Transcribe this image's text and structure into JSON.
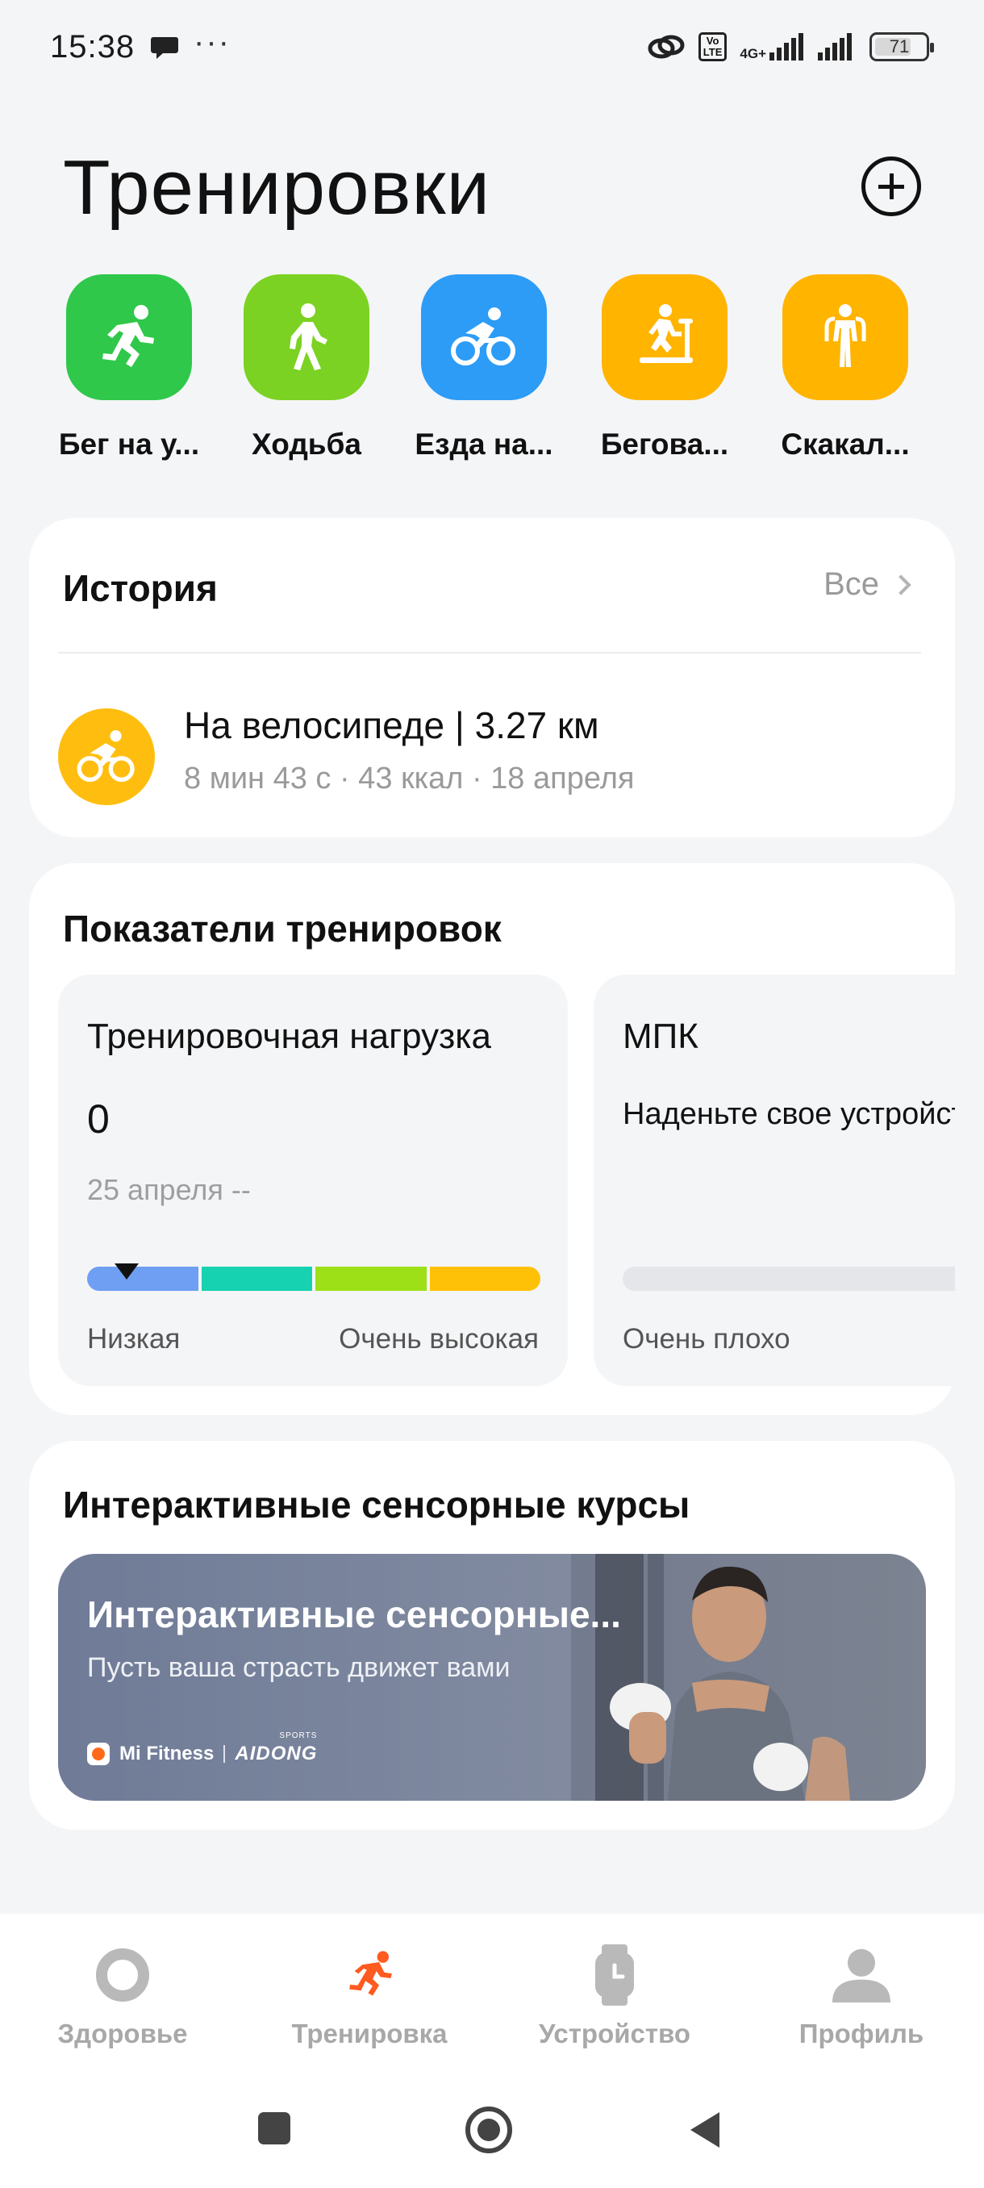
{
  "status_bar": {
    "time": "15:38",
    "dots": "···",
    "network": "4G+",
    "volte_top": "Vo",
    "volte_bottom": "LTE",
    "battery": "71"
  },
  "header": {
    "title": "Тренировки"
  },
  "workout_types": [
    {
      "label": "Бег на у...",
      "icon": "running-icon",
      "color": "#2fc84a"
    },
    {
      "label": "Ходьба",
      "icon": "walking-icon",
      "color": "#7bd222"
    },
    {
      "label": "Езда на...",
      "icon": "cycling-icon",
      "color": "#2c9cf7"
    },
    {
      "label": "Бегова...",
      "icon": "treadmill-icon",
      "color": "#ffb400"
    },
    {
      "label": "Скакал...",
      "icon": "jump-rope-icon",
      "color": "#ffb400"
    }
  ],
  "history": {
    "title": "История",
    "see_all": "Все",
    "item": {
      "title": "На велосипеде | 3.27 км",
      "subtitle": "8 мин 43 с · 43 ккал · 18 апреля",
      "icon": "cycling-icon",
      "color": "#ffbe0f"
    }
  },
  "metrics": {
    "title": "Показатели тренировок",
    "load": {
      "title": "Тренировочная нагрузка",
      "value": "0",
      "date": "25 апреля --",
      "low_label": "Низкая",
      "high_label": "Очень высокая",
      "scale_colors": [
        "#6f9ff3",
        "#16d2b0",
        "#9de018",
        "#ffc107"
      ]
    },
    "vo2": {
      "title": "МПК",
      "message": "Наденьте свое устройство",
      "low_label": "Очень плохо"
    }
  },
  "courses": {
    "title": "Интерактивные сенсорные курсы",
    "banner_title": "Интерактивные сенсорные...",
    "banner_subtitle": "Пусть ваша страсть движет вами",
    "brand_1": "Mi Fitness",
    "brand_2": "AIDONG",
    "brand_2_small": "SPORTS"
  },
  "bottom_nav": [
    {
      "label": "Здоровье",
      "icon": "health-ring-icon",
      "active": false
    },
    {
      "label": "Тренировка",
      "icon": "running-icon",
      "active": true,
      "color": "#ff5a1f"
    },
    {
      "label": "Устройство",
      "icon": "watch-icon",
      "active": false
    },
    {
      "label": "Профиль",
      "icon": "profile-icon",
      "active": false
    }
  ]
}
